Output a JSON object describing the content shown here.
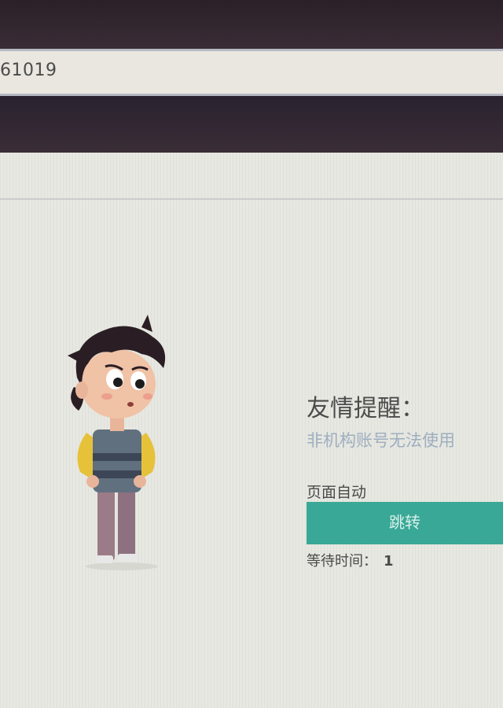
{
  "browser": {
    "address_text": "61019"
  },
  "notice": {
    "title": "友情提醒：",
    "message": "非机构账号无法使用",
    "auto_label": "页面自动",
    "jump_button_label": "跳转",
    "wait_label": "等待时间：",
    "wait_seconds": "1"
  },
  "colors": {
    "accent": "#3aa896",
    "message_text": "#9eaec0",
    "background": "#e7e8e1"
  },
  "icons": {
    "illustration": "worried-boy-illustration"
  }
}
